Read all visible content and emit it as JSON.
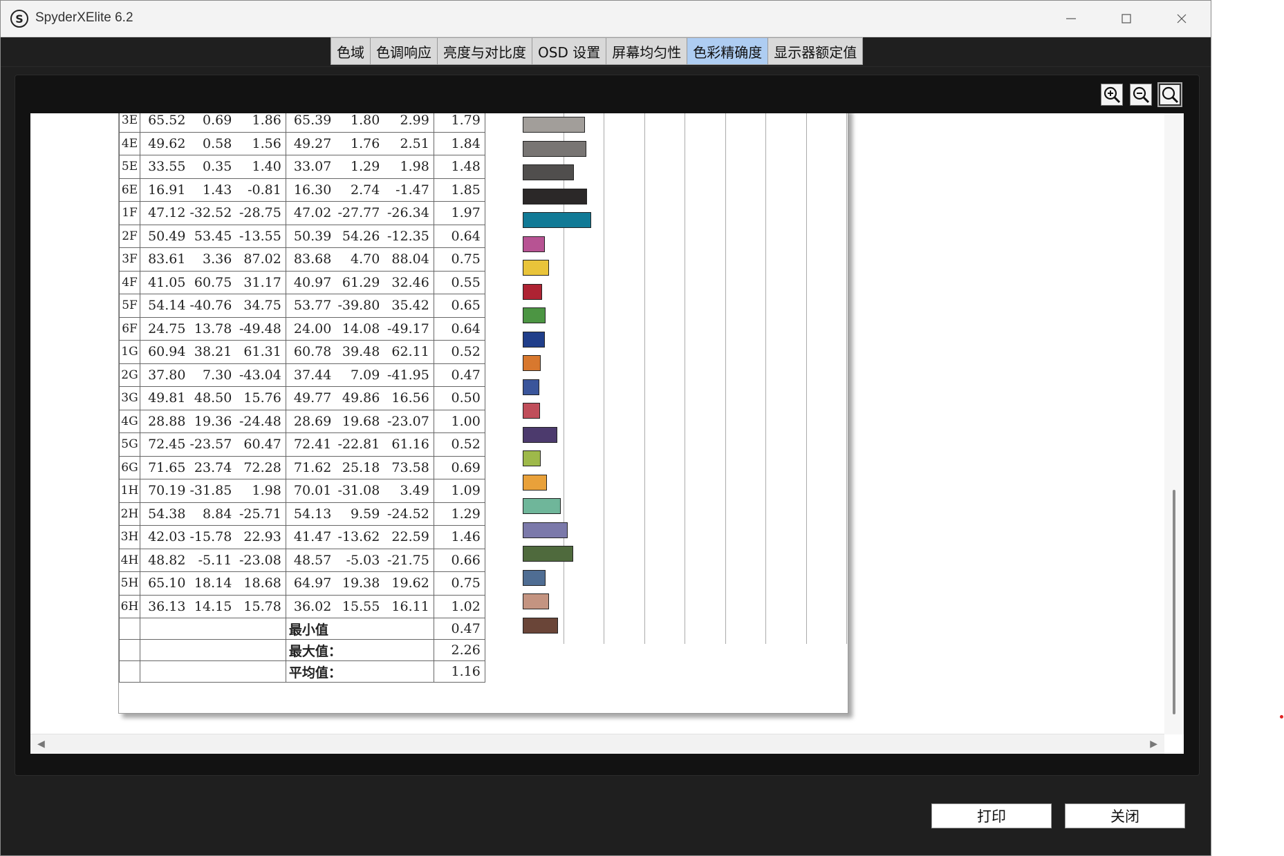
{
  "window": {
    "title": "SpyderXElite 6.2",
    "logo_letter": "S"
  },
  "tabs": [
    {
      "label": "色域",
      "active": false
    },
    {
      "label": "色调响应",
      "active": false
    },
    {
      "label": "亮度与对比度",
      "active": false
    },
    {
      "label": "OSD 设置",
      "active": false
    },
    {
      "label": "屏幕均匀性",
      "active": false
    },
    {
      "label": "色彩精确度",
      "active": true
    },
    {
      "label": "显示器额定值",
      "active": false
    }
  ],
  "toolbar": {
    "zoom_in_icon": "zoom-in-icon",
    "zoom_out_icon": "zoom-out-icon",
    "zoom_fit_icon": "zoom-fit-icon"
  },
  "report": {
    "rows": [
      {
        "id": "3E",
        "v": [
          "65.52",
          "0.69",
          "1.86",
          "65.39",
          "1.80",
          "2.99"
        ],
        "de": "1.79",
        "color": "#a29e9a"
      },
      {
        "id": "4E",
        "v": [
          "49.62",
          "0.58",
          "1.56",
          "49.27",
          "1.76",
          "2.51"
        ],
        "de": "1.84",
        "color": "#787573"
      },
      {
        "id": "5E",
        "v": [
          "33.55",
          "0.35",
          "1.40",
          "33.07",
          "1.29",
          "1.98"
        ],
        "de": "1.48",
        "color": "#504e4d"
      },
      {
        "id": "6E",
        "v": [
          "16.91",
          "1.43",
          "-0.81",
          "16.30",
          "2.74",
          "-1.47"
        ],
        "de": "1.85",
        "color": "#2b2828"
      },
      {
        "id": "1F",
        "v": [
          "47.12",
          "-32.52",
          "-28.75",
          "47.02",
          "-27.77",
          "-26.34"
        ],
        "de": "1.97",
        "color": "#117a96"
      },
      {
        "id": "2F",
        "v": [
          "50.49",
          "53.45",
          "-13.55",
          "50.39",
          "54.26",
          "-12.35"
        ],
        "de": "0.64",
        "color": "#b75393"
      },
      {
        "id": "3F",
        "v": [
          "83.61",
          "3.36",
          "87.02",
          "83.68",
          "4.70",
          "88.04"
        ],
        "de": "0.75",
        "color": "#e9c43a"
      },
      {
        "id": "4F",
        "v": [
          "41.05",
          "60.75",
          "31.17",
          "40.97",
          "61.29",
          "32.46"
        ],
        "de": "0.55",
        "color": "#ae2333"
      },
      {
        "id": "5F",
        "v": [
          "54.14",
          "-40.76",
          "34.75",
          "53.77",
          "-39.80",
          "35.42"
        ],
        "de": "0.65",
        "color": "#4c9543"
      },
      {
        "id": "6F",
        "v": [
          "24.75",
          "13.78",
          "-49.48",
          "24.00",
          "14.08",
          "-49.17"
        ],
        "de": "0.64",
        "color": "#203e8a"
      },
      {
        "id": "1G",
        "v": [
          "60.94",
          "38.21",
          "61.31",
          "60.78",
          "39.48",
          "62.11"
        ],
        "de": "0.52",
        "color": "#d8782e"
      },
      {
        "id": "2G",
        "v": [
          "37.80",
          "7.30",
          "-43.04",
          "37.44",
          "7.09",
          "-41.95"
        ],
        "de": "0.47",
        "color": "#3a559b"
      },
      {
        "id": "3G",
        "v": [
          "49.81",
          "48.50",
          "15.76",
          "49.77",
          "49.86",
          "16.56"
        ],
        "de": "0.50",
        "color": "#c04e5a"
      },
      {
        "id": "4G",
        "v": [
          "28.88",
          "19.36",
          "-24.48",
          "28.69",
          "19.68",
          "-23.07"
        ],
        "de": "1.00",
        "color": "#4c3a6d"
      },
      {
        "id": "5G",
        "v": [
          "72.45",
          "-23.57",
          "60.47",
          "72.41",
          "-22.81",
          "61.16"
        ],
        "de": "0.52",
        "color": "#9eb94a"
      },
      {
        "id": "6G",
        "v": [
          "71.65",
          "23.74",
          "72.28",
          "71.62",
          "25.18",
          "73.58"
        ],
        "de": "0.69",
        "color": "#e9a13a"
      },
      {
        "id": "1H",
        "v": [
          "70.19",
          "-31.85",
          "1.98",
          "70.01",
          "-31.08",
          "3.49"
        ],
        "de": "1.09",
        "color": "#6fb69a"
      },
      {
        "id": "2H",
        "v": [
          "54.38",
          "8.84",
          "-25.71",
          "54.13",
          "9.59",
          "-24.52"
        ],
        "de": "1.29",
        "color": "#7b79aa"
      },
      {
        "id": "3H",
        "v": [
          "42.03",
          "-15.78",
          "22.93",
          "41.47",
          "-13.62",
          "22.59"
        ],
        "de": "1.46",
        "color": "#4f6a3d"
      },
      {
        "id": "4H",
        "v": [
          "48.82",
          "-5.11",
          "-23.08",
          "48.57",
          "-5.03",
          "-21.75"
        ],
        "de": "0.66",
        "color": "#4f6d93"
      },
      {
        "id": "5H",
        "v": [
          "65.10",
          "18.14",
          "18.68",
          "64.97",
          "19.38",
          "19.62"
        ],
        "de": "0.75",
        "color": "#c49481"
      },
      {
        "id": "6H",
        "v": [
          "36.13",
          "14.15",
          "15.78",
          "36.02",
          "15.55",
          "16.11"
        ],
        "de": "1.02",
        "color": "#6a4538"
      }
    ],
    "summary": [
      {
        "label": "最小值",
        "value": "0.47"
      },
      {
        "label": "最大值：",
        "value": "2.26"
      },
      {
        "label": "平均值：",
        "value": "1.16"
      }
    ]
  },
  "buttons": {
    "print": "打印",
    "close": "关闭"
  }
}
